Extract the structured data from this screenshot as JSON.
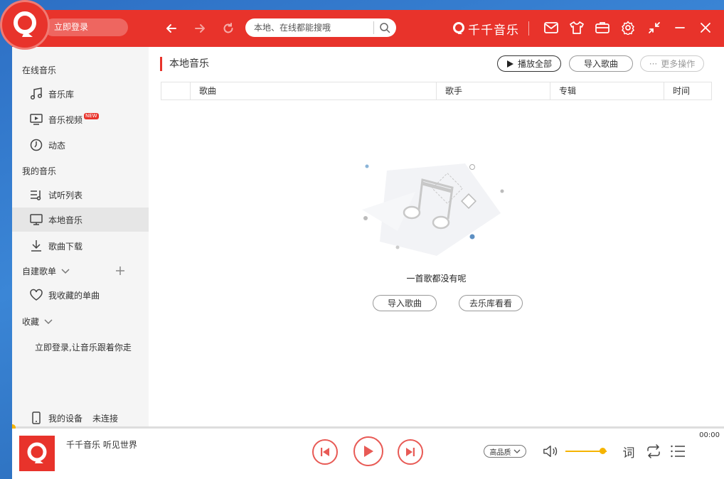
{
  "header": {
    "login_label": "立即登录",
    "search_placeholder": "本地、在线都能搜哦",
    "brand_name": "千千音乐"
  },
  "sidebar": {
    "online_section": "在线音乐",
    "library": "音乐库",
    "video": "音乐视频",
    "video_badge": "NEW",
    "feed": "动态",
    "my_section": "我的音乐",
    "trial_list": "试听列表",
    "local_music": "本地音乐",
    "downloads": "歌曲下载",
    "custom_playlists": "自建歌单",
    "favorites": "我收藏的单曲",
    "collection": "收藏",
    "login_hint": "立即登录,让音乐跟着你走",
    "device": "我的设备",
    "device_status": "未连接"
  },
  "content": {
    "title": "本地音乐",
    "play_all": "播放全部",
    "import_songs": "导入歌曲",
    "more_actions": "更多操作",
    "columns": [
      "歌曲",
      "歌手",
      "专辑",
      "时间"
    ],
    "empty_text": "一首歌都没有呢",
    "empty_import": "导入歌曲",
    "empty_browse": "去乐库看看"
  },
  "player": {
    "track": "千千音乐 听见世界",
    "time": "00:00",
    "quality": "高品质",
    "lyrics_label": "词",
    "volume_level": 0.9,
    "progress": 0.0
  },
  "colors": {
    "accent": "#e8332b",
    "volume": "#f5b400"
  }
}
